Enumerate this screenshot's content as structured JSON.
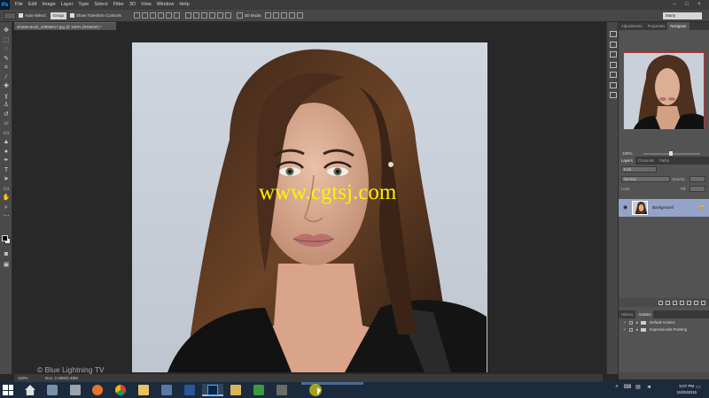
{
  "app": {
    "logo": "Ps",
    "menu": [
      "File",
      "Edit",
      "Image",
      "Layer",
      "Type",
      "Select",
      "Filter",
      "3D",
      "View",
      "Window",
      "Help"
    ],
    "window_controls": [
      "–",
      "□",
      "×"
    ]
  },
  "options_bar": {
    "auto_select_label": "Auto-Select:",
    "auto_select_value": "Group",
    "show_transform_label": "Show Transform Controls",
    "mode_3d_label": "3D Mode:",
    "workspace": "Marty"
  },
  "document": {
    "tab_title": "shutterstock_23856617.jpg @ 100% (RGB/8#) *",
    "watermark": "www.cgtsj.com",
    "credit": "© Blue Lightning TV",
    "status_zoom": "100%",
    "status_doc": "Doc: 2.49M/2.49M"
  },
  "navigator_panel": {
    "tabs": [
      "Adjustments",
      "Properties",
      "Navigator"
    ],
    "active_tab": "Navigator",
    "zoom": "100%"
  },
  "layers_panel": {
    "tabs": [
      "Layers",
      "Channels",
      "Paths"
    ],
    "active_tab": "Layers",
    "filter": "Kind",
    "blend_mode": "Normal",
    "opacity_label": "Opacity:",
    "lock_label": "Lock:",
    "fill_label": "Fill:",
    "layers": [
      {
        "name": "Background",
        "locked": true,
        "visible": true
      }
    ]
  },
  "actions_panel": {
    "tabs": [
      "History",
      "Actions"
    ],
    "active_tab": "Actions",
    "sets": [
      {
        "name": "Default Actions",
        "checked": true
      },
      {
        "name": "Impressionist Painting",
        "checked": true
      }
    ]
  },
  "taskbar": {
    "time": "5:07 PM",
    "date": "10/25/2015"
  },
  "colors": {
    "watermark": "#fff200",
    "selected_layer": "#96a3c8",
    "navigator_box": "#bb3333"
  }
}
